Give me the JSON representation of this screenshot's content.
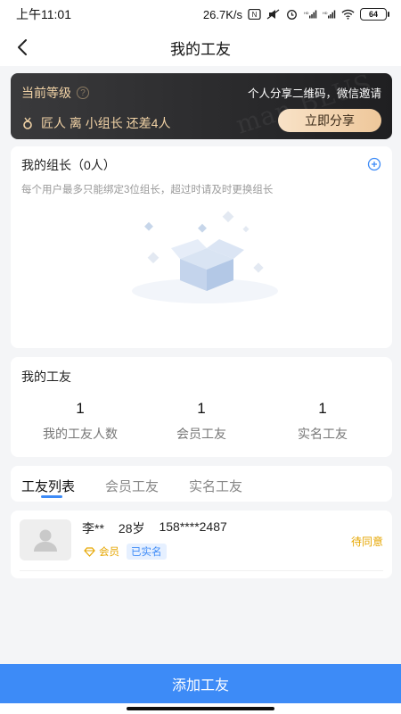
{
  "status_bar": {
    "time": "上午11:01",
    "network_speed": "26.7K/s",
    "battery": "64"
  },
  "header": {
    "title": "我的工友"
  },
  "level_card": {
    "label": "当前等级",
    "invite_text": "个人分享二维码，微信邀请",
    "status_text": "匠人 离 小组长 还差4人",
    "share_button": "立即分享",
    "watermark": "man BLUS"
  },
  "leader_section": {
    "title": "我的组长（0人）",
    "hint": "每个用户最多只能绑定3位组长，超过时请及时更换组长"
  },
  "team_section": {
    "title": "我的工友",
    "stats": [
      {
        "value": "1",
        "label": "我的工友人数"
      },
      {
        "value": "1",
        "label": "会员工友"
      },
      {
        "value": "1",
        "label": "实名工友"
      }
    ]
  },
  "tabs": [
    {
      "label": "工友列表"
    },
    {
      "label": "会员工友"
    },
    {
      "label": "实名工友"
    }
  ],
  "members": [
    {
      "name": "李**",
      "age": "28岁",
      "phone": "158****2487",
      "vip_label": "会员",
      "real_label": "已实名",
      "status": "待同意"
    }
  ],
  "footer": {
    "add_button": "添加工友"
  },
  "colors": {
    "accent": "#3d8bf7",
    "gold": "#f2d3a6",
    "pending": "#e6a600"
  }
}
